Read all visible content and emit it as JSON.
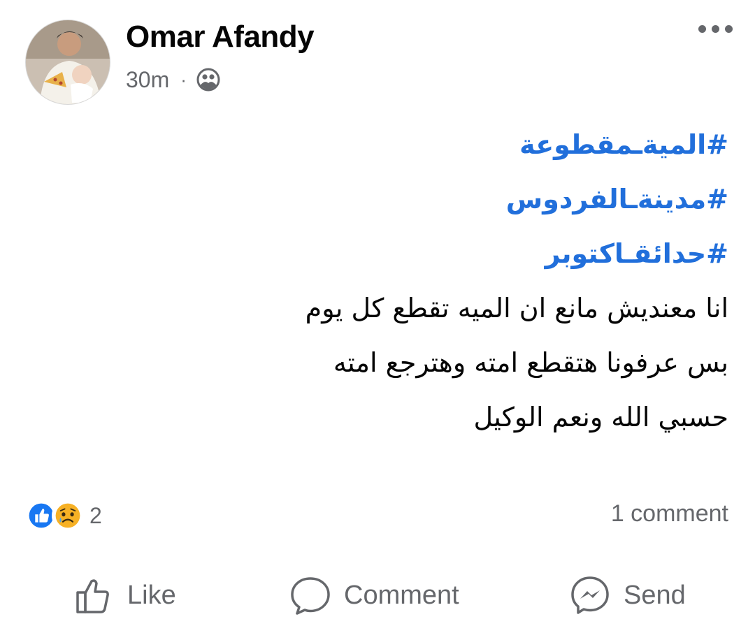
{
  "post": {
    "author": "Omar Afandy",
    "timestamp": "30m",
    "separator": "·",
    "audience_icon": "friends-icon",
    "more_icon": "more-options-icon",
    "hashtags": [
      "#الميةـمقطوعة",
      "#مدينةـالفردوس",
      "#حدائقـاكتوبر"
    ],
    "lines": [
      "انا معنديش مانع ان الميه تقطع كل يوم",
      "بس عرفونا هتقطع امته وهترجع امته",
      "حسبي الله ونعم الوكيل"
    ],
    "reactions": {
      "icons": [
        "like-icon",
        "sad-icon"
      ],
      "count": "2"
    },
    "comments_label": "1 comment"
  },
  "actions": {
    "like": {
      "label": "Like",
      "icon": "thumbs-up-icon"
    },
    "comment": {
      "label": "Comment",
      "icon": "comment-bubble-icon"
    },
    "send": {
      "label": "Send",
      "icon": "messenger-icon"
    }
  },
  "colors": {
    "hashtag": "#216fdb",
    "secondary_text": "#65676b",
    "like_blue": "#1877f2",
    "sad_yellow": "#f7b125"
  }
}
